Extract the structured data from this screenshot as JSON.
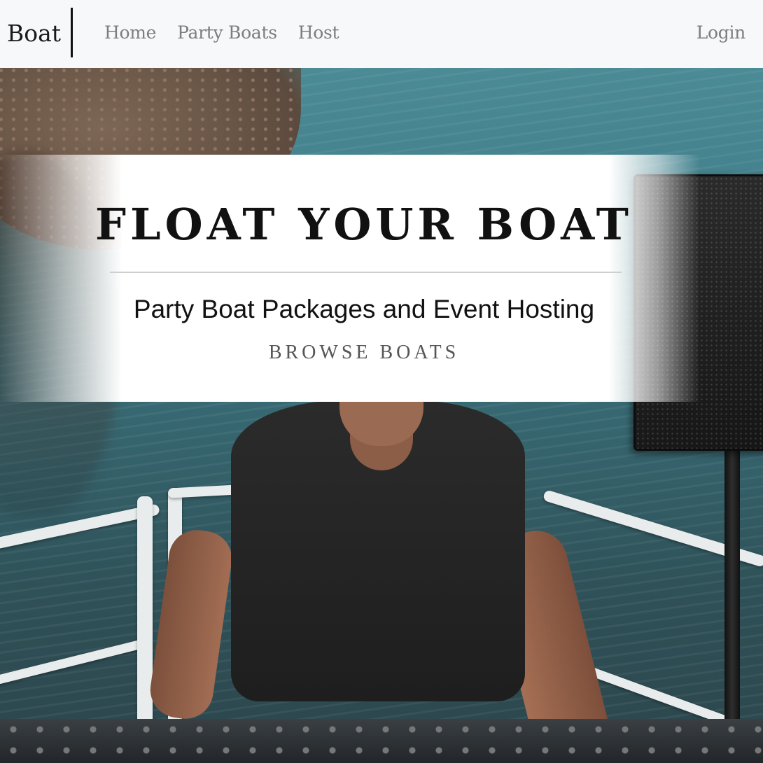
{
  "navbar": {
    "brand": "Boat",
    "links": [
      "Home",
      "Party Boats",
      "Host"
    ],
    "login": "Login"
  },
  "hero": {
    "image_alt": "DJ playing music on a boat deck over the water",
    "title": "FLOAT YOUR BOAT",
    "subtitle": "Party Boat Packages and Event Hosting",
    "cta": "BROWSE BOATS"
  },
  "colors": {
    "navbar_bg": "#f7f8fa",
    "nav_link": "#7d7d7d",
    "brand_text": "#1a1a1a",
    "banner_bg": "#ffffff",
    "cta_text": "#555555"
  }
}
